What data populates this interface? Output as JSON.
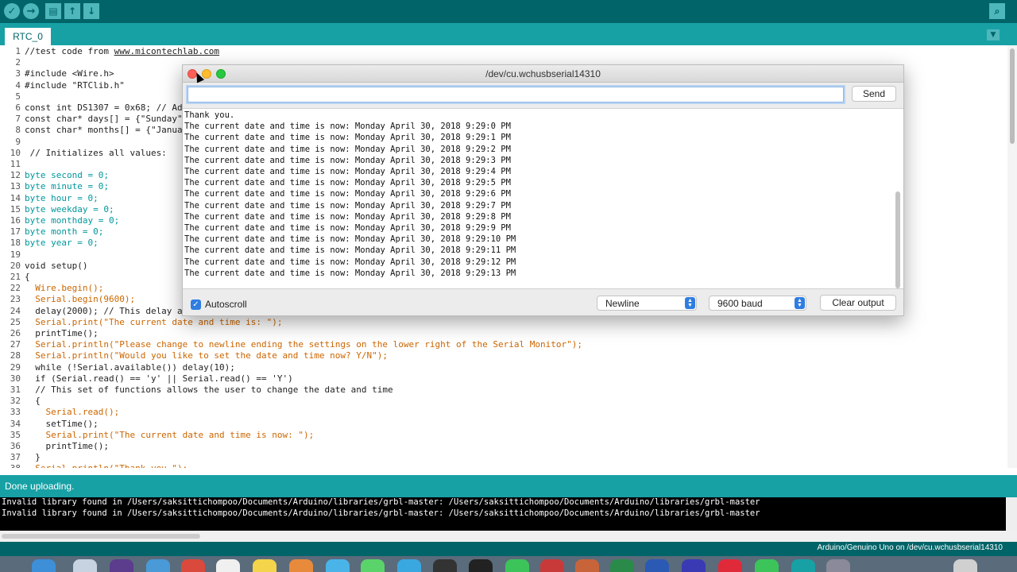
{
  "toolbar": {
    "verify_icon": "check-icon",
    "upload_icon": "arrow-right-icon",
    "new_icon": "document-icon",
    "open_icon": "arrow-up-icon",
    "save_icon": "arrow-down-icon",
    "serial_monitor_icon": "magnifier-icon"
  },
  "tabs": [
    {
      "label": "RTC_0"
    }
  ],
  "editor": {
    "lines": [
      {
        "n": "1",
        "text": "//test code from "
      },
      {
        "n": "2",
        "text": ""
      },
      {
        "n": "3",
        "text": "#include <Wire.h>"
      },
      {
        "n": "4",
        "text": "#include \"RTClib.h\""
      },
      {
        "n": "5",
        "text": ""
      },
      {
        "n": "6",
        "text": "const int DS1307 = 0x68; // Addr"
      },
      {
        "n": "7",
        "text": "const char* days[] = {\"Sunday\","
      },
      {
        "n": "8",
        "text": "const char* months[] = {\"January"
      },
      {
        "n": "9",
        "text": ""
      },
      {
        "n": "10",
        "text": " // Initializes all values:"
      },
      {
        "n": "11",
        "text": ""
      },
      {
        "n": "12",
        "text": "byte second = 0;"
      },
      {
        "n": "13",
        "text": "byte minute = 0;"
      },
      {
        "n": "14",
        "text": "byte hour = 0;"
      },
      {
        "n": "15",
        "text": "byte weekday = 0;"
      },
      {
        "n": "16",
        "text": "byte monthday = 0;"
      },
      {
        "n": "17",
        "text": "byte month = 0;"
      },
      {
        "n": "18",
        "text": "byte year = 0;"
      },
      {
        "n": "19",
        "text": ""
      },
      {
        "n": "20",
        "text": "void setup()"
      },
      {
        "n": "21",
        "text": "{"
      },
      {
        "n": "22",
        "text": "  Wire.begin();"
      },
      {
        "n": "23",
        "text": "  Serial.begin(9600);"
      },
      {
        "n": "24",
        "text": "  delay(2000); // This delay all"
      },
      {
        "n": "25",
        "text": "  Serial.print(\"The current date and time is: \");"
      },
      {
        "n": "26",
        "text": "  printTime();"
      },
      {
        "n": "27",
        "text": "  Serial.println(\"Please change to newline ending the settings on the lower right of the Serial Monitor\");"
      },
      {
        "n": "28",
        "text": "  Serial.println(\"Would you like to set the date and time now? Y/N\");"
      },
      {
        "n": "29",
        "text": "  while (!Serial.available()) delay(10);"
      },
      {
        "n": "30",
        "text": "  if (Serial.read() == 'y' || Serial.read() == 'Y')"
      },
      {
        "n": "31",
        "text": "  // This set of functions allows the user to change the date and time"
      },
      {
        "n": "32",
        "text": "  {"
      },
      {
        "n": "33",
        "text": "    Serial.read();"
      },
      {
        "n": "34",
        "text": "    setTime();"
      },
      {
        "n": "35",
        "text": "    Serial.print(\"The current date and time is now: \");"
      },
      {
        "n": "36",
        "text": "    printTime();"
      },
      {
        "n": "37",
        "text": "  }"
      },
      {
        "n": "38",
        "text": "  Serial.println(\"Thank you.\");"
      }
    ],
    "link_text": "www.micontechlab.com"
  },
  "status": {
    "message": "Done uploading."
  },
  "console": {
    "lines": [
      "Invalid library found in /Users/saksittichompoo/Documents/Arduino/libraries/grbl-master: /Users/saksittichompoo/Documents/Arduino/libraries/grbl-master",
      "Invalid library found in /Users/saksittichompoo/Documents/Arduino/libraries/grbl-master: /Users/saksittichompoo/Documents/Arduino/libraries/grbl-master"
    ]
  },
  "footer": {
    "board": "Arduino/Genuino Uno on /dev/cu.wchusbserial14310"
  },
  "serial_monitor": {
    "title": "/dev/cu.wchusbserial14310",
    "input_value": "",
    "send_label": "Send",
    "output": [
      "Thank you.",
      "The current date and time is now: Monday April 30, 2018 9:29:0 PM",
      "The current date and time is now: Monday April 30, 2018 9:29:1 PM",
      "The current date and time is now: Monday April 30, 2018 9:29:2 PM",
      "The current date and time is now: Monday April 30, 2018 9:29:3 PM",
      "The current date and time is now: Monday April 30, 2018 9:29:4 PM",
      "The current date and time is now: Monday April 30, 2018 9:29:5 PM",
      "The current date and time is now: Monday April 30, 2018 9:29:6 PM",
      "The current date and time is now: Monday April 30, 2018 9:29:7 PM",
      "The current date and time is now: Monday April 30, 2018 9:29:8 PM",
      "The current date and time is now: Monday April 30, 2018 9:29:9 PM",
      "The current date and time is now: Monday April 30, 2018 9:29:10 PM",
      "The current date and time is now: Monday April 30, 2018 9:29:11 PM",
      "The current date and time is now: Monday April 30, 2018 9:29:12 PM",
      "The current date and time is now: Monday April 30, 2018 9:29:13 PM"
    ],
    "autoscroll_label": "Autoscroll",
    "autoscroll_checked": true,
    "line_ending": "Newline",
    "baud": "9600 baud",
    "clear_label": "Clear output"
  },
  "colors": {
    "toolbar": "#006468",
    "tabbar": "#17a1a5",
    "keyword": "#cc6600",
    "type": "#00979c"
  }
}
